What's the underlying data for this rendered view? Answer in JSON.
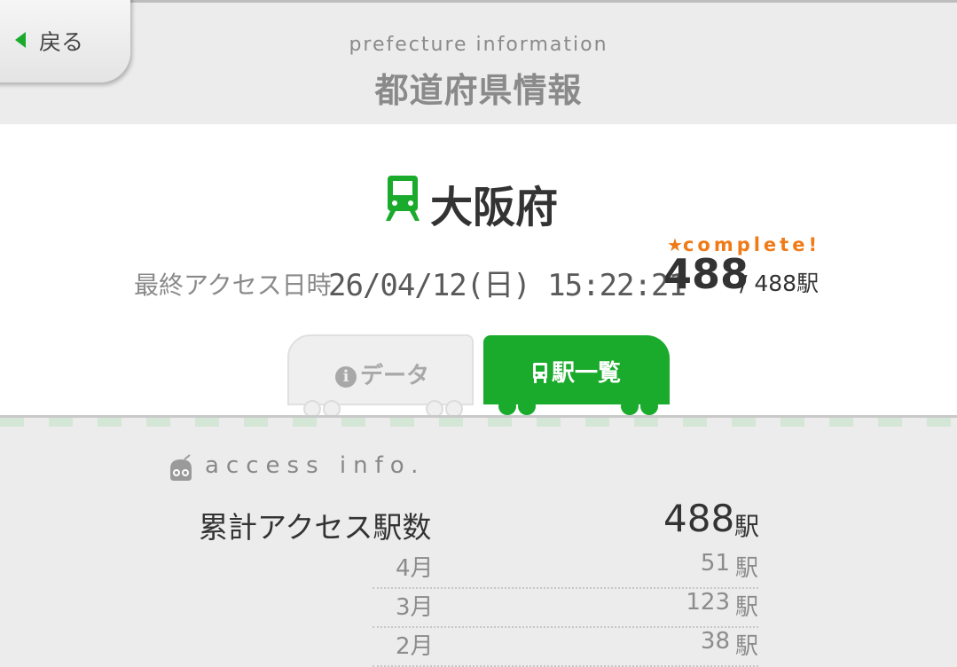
{
  "header": {
    "back_label": "戻る",
    "subtitle": "prefecture information",
    "title": "都道府県情報"
  },
  "prefecture": {
    "name": "大阪府",
    "last_access_label": "最終アクセス日時",
    "last_access_time": "26/04/12(日) 15:22:21",
    "complete_label": "complete!",
    "accessed_count": "488",
    "total_text": "/ 488駅"
  },
  "tabs": {
    "data_label": "データ",
    "list_label": "駅一覧",
    "active": "駅一覧"
  },
  "access_info": {
    "heading": "access info.",
    "total_label": "累計アクセス駅数",
    "total_value": "488",
    "unit": "駅",
    "months": [
      {
        "label": "4月",
        "value": "51",
        "unit": "駅"
      },
      {
        "label": "3月",
        "value": "123",
        "unit": "駅"
      },
      {
        "label": "2月",
        "value": "38",
        "unit": "駅"
      }
    ]
  },
  "colors": {
    "accent_green": "#1aaa2c",
    "complete_orange": "#f07a16",
    "header_bg": "#ececec"
  }
}
